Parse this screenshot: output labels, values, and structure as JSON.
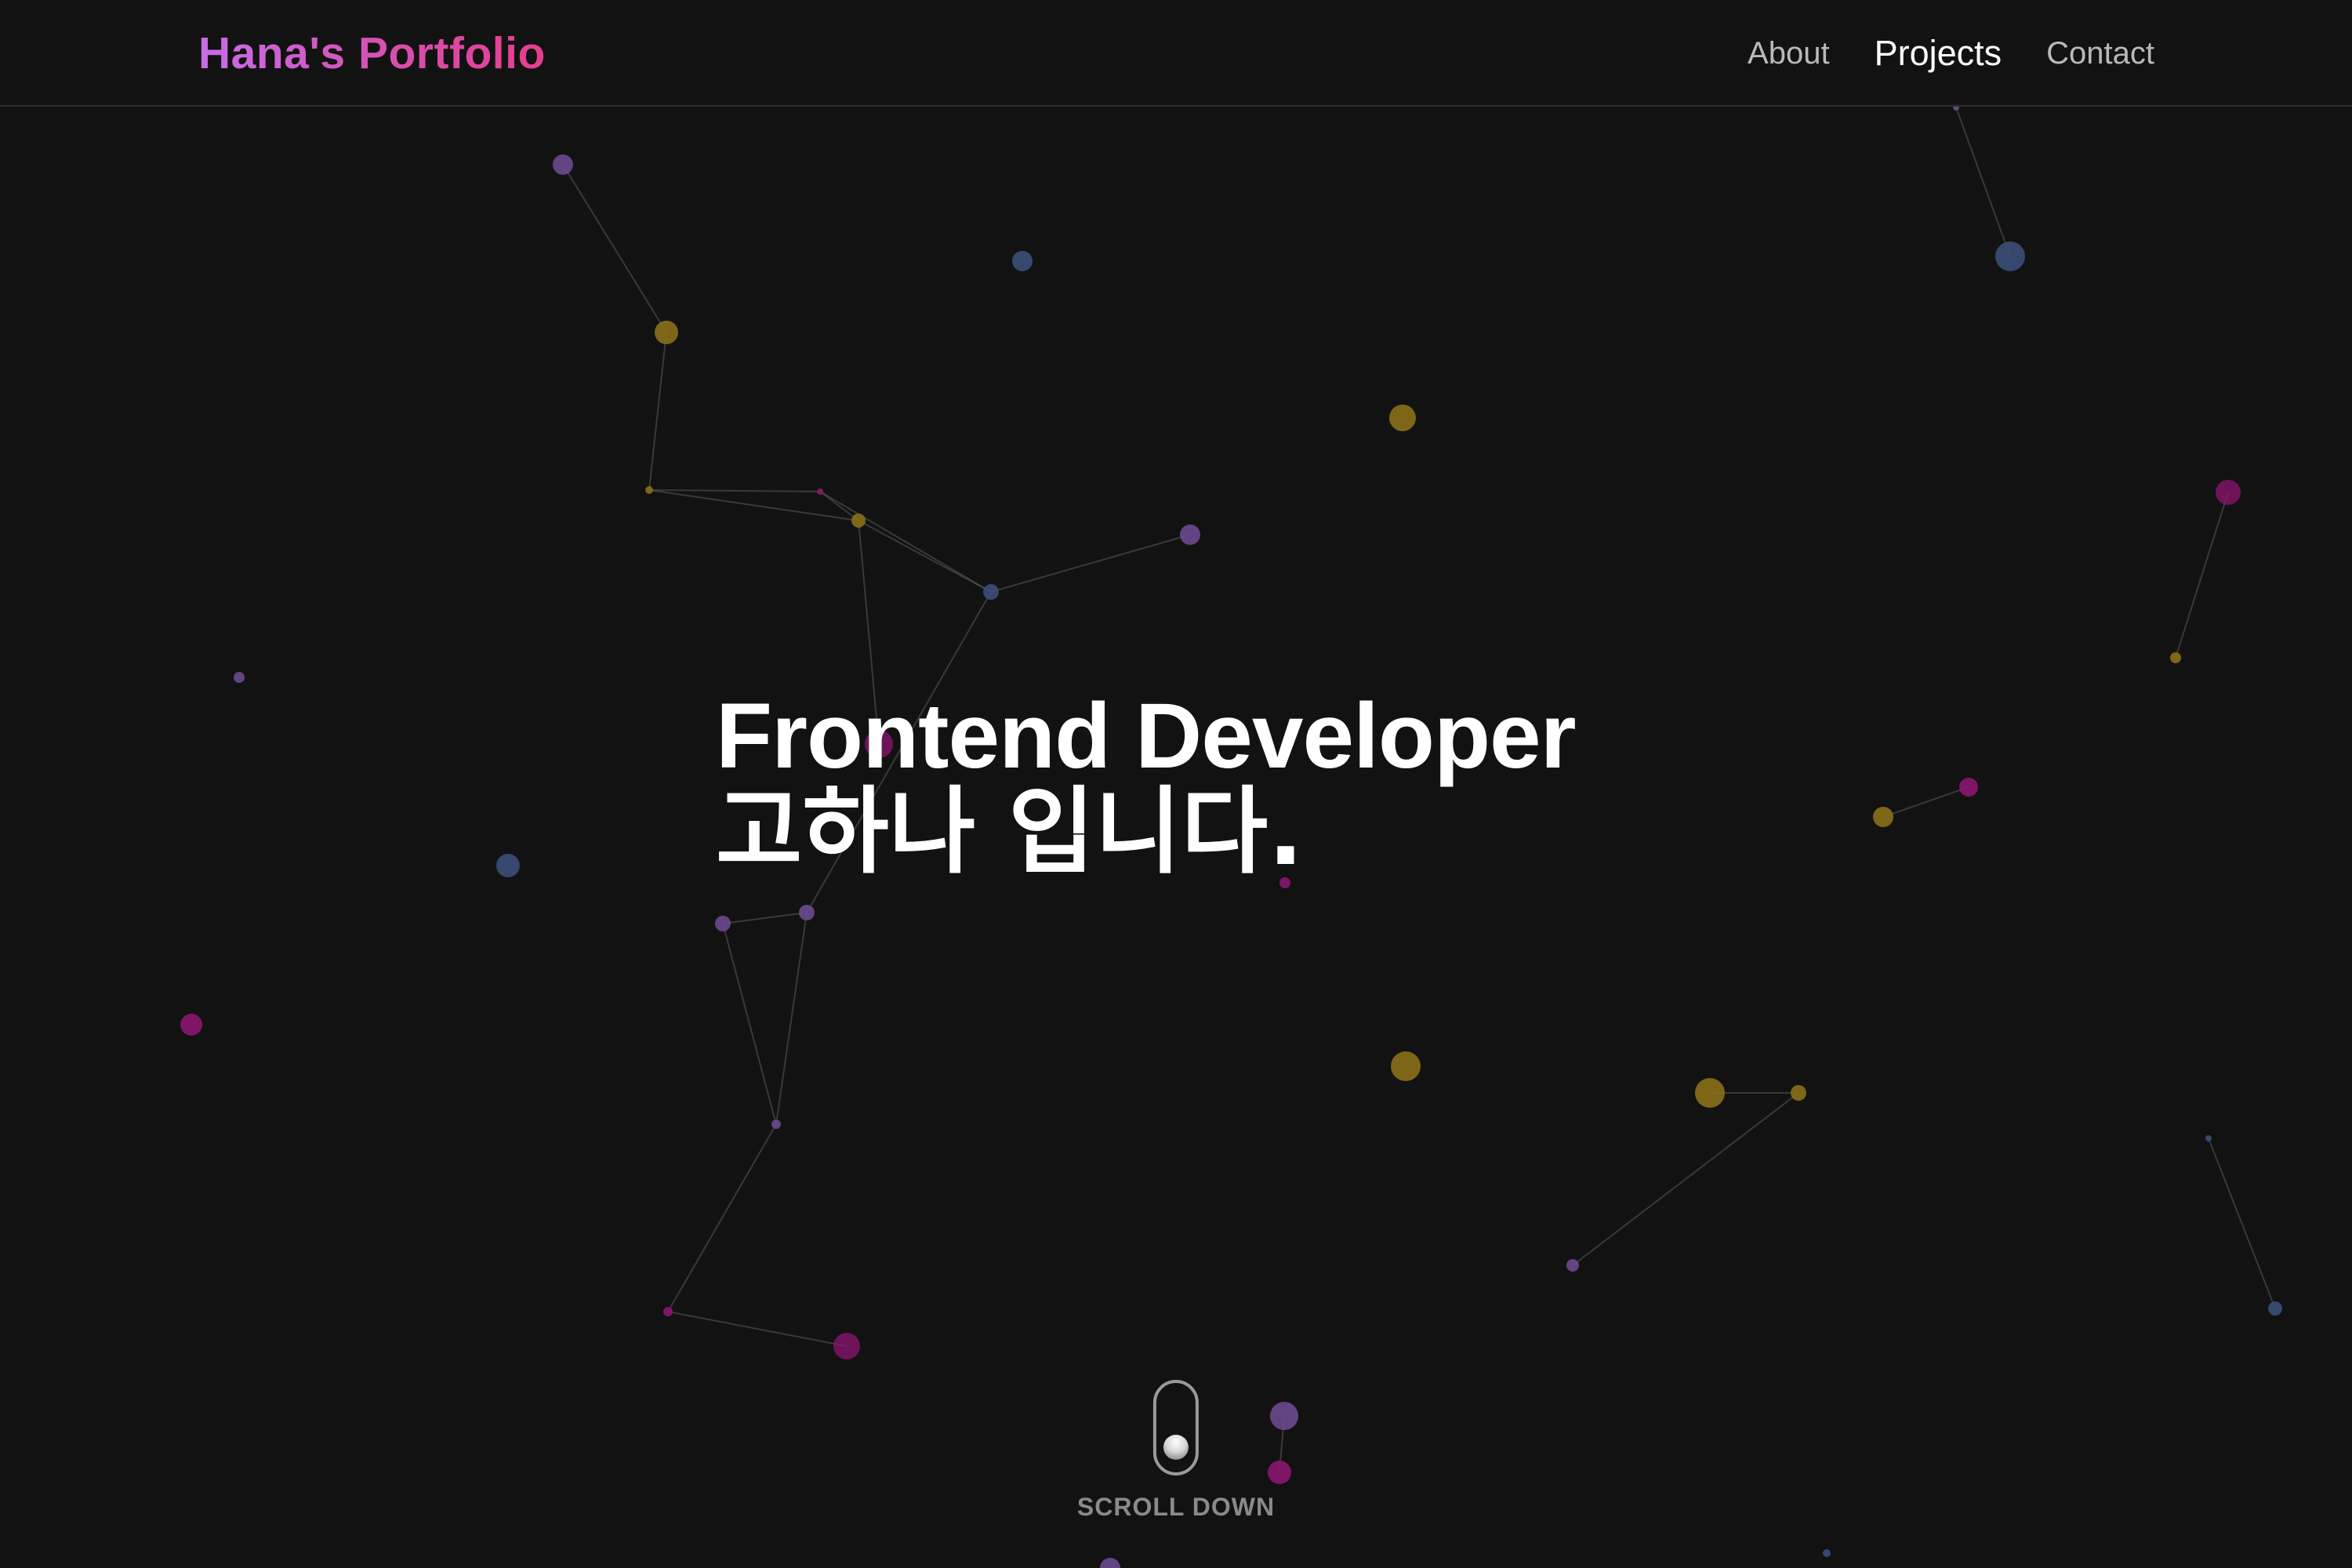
{
  "header": {
    "brand": "Hana's Portfolio",
    "nav": [
      {
        "label": "About",
        "active": false
      },
      {
        "label": "Projects",
        "active": true
      },
      {
        "label": "Contact",
        "active": false
      }
    ]
  },
  "hero": {
    "line1": "Frontend Developer",
    "line2": "고하나 입니다."
  },
  "scroll": {
    "label": "SCROLL DOWN"
  },
  "colors": {
    "background": "#121212",
    "brand_gradient": [
      "#c56ee8",
      "#e53e8c"
    ],
    "particle_purple": "#6b4a8f",
    "particle_gold": "#8a7018",
    "particle_blue": "#3b4f78",
    "particle_magenta": "#8c1670"
  }
}
